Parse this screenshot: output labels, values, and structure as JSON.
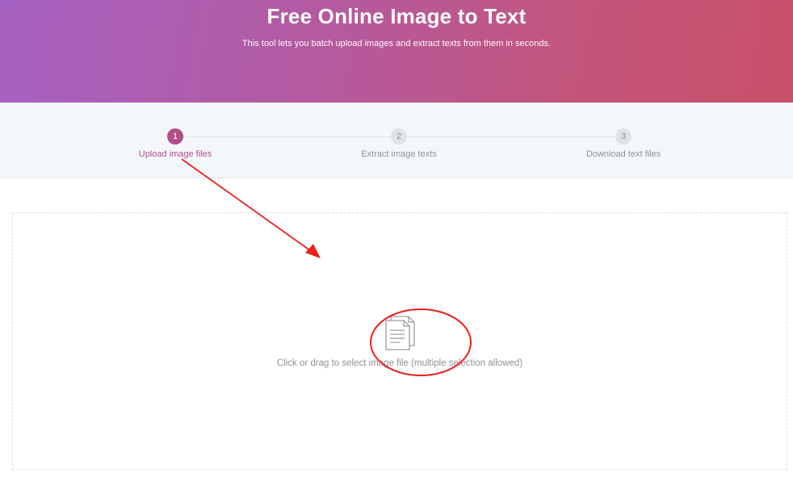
{
  "hero": {
    "title": "Free Online Image to Text",
    "subtitle": "This tool lets you batch upload images and extract texts from them in seconds."
  },
  "steps": [
    {
      "number": "1",
      "label": "Upload image files",
      "state": "active"
    },
    {
      "number": "2",
      "label": "Extract image texts",
      "state": "inactive"
    },
    {
      "number": "3",
      "label": "Download text files",
      "state": "inactive"
    }
  ],
  "dropzone": {
    "icon": "document-icon",
    "text": "Click or drag to select image file (multiple selection allowed)"
  },
  "colors": {
    "accent": "#b04d88",
    "annotation": "#e8221b"
  }
}
